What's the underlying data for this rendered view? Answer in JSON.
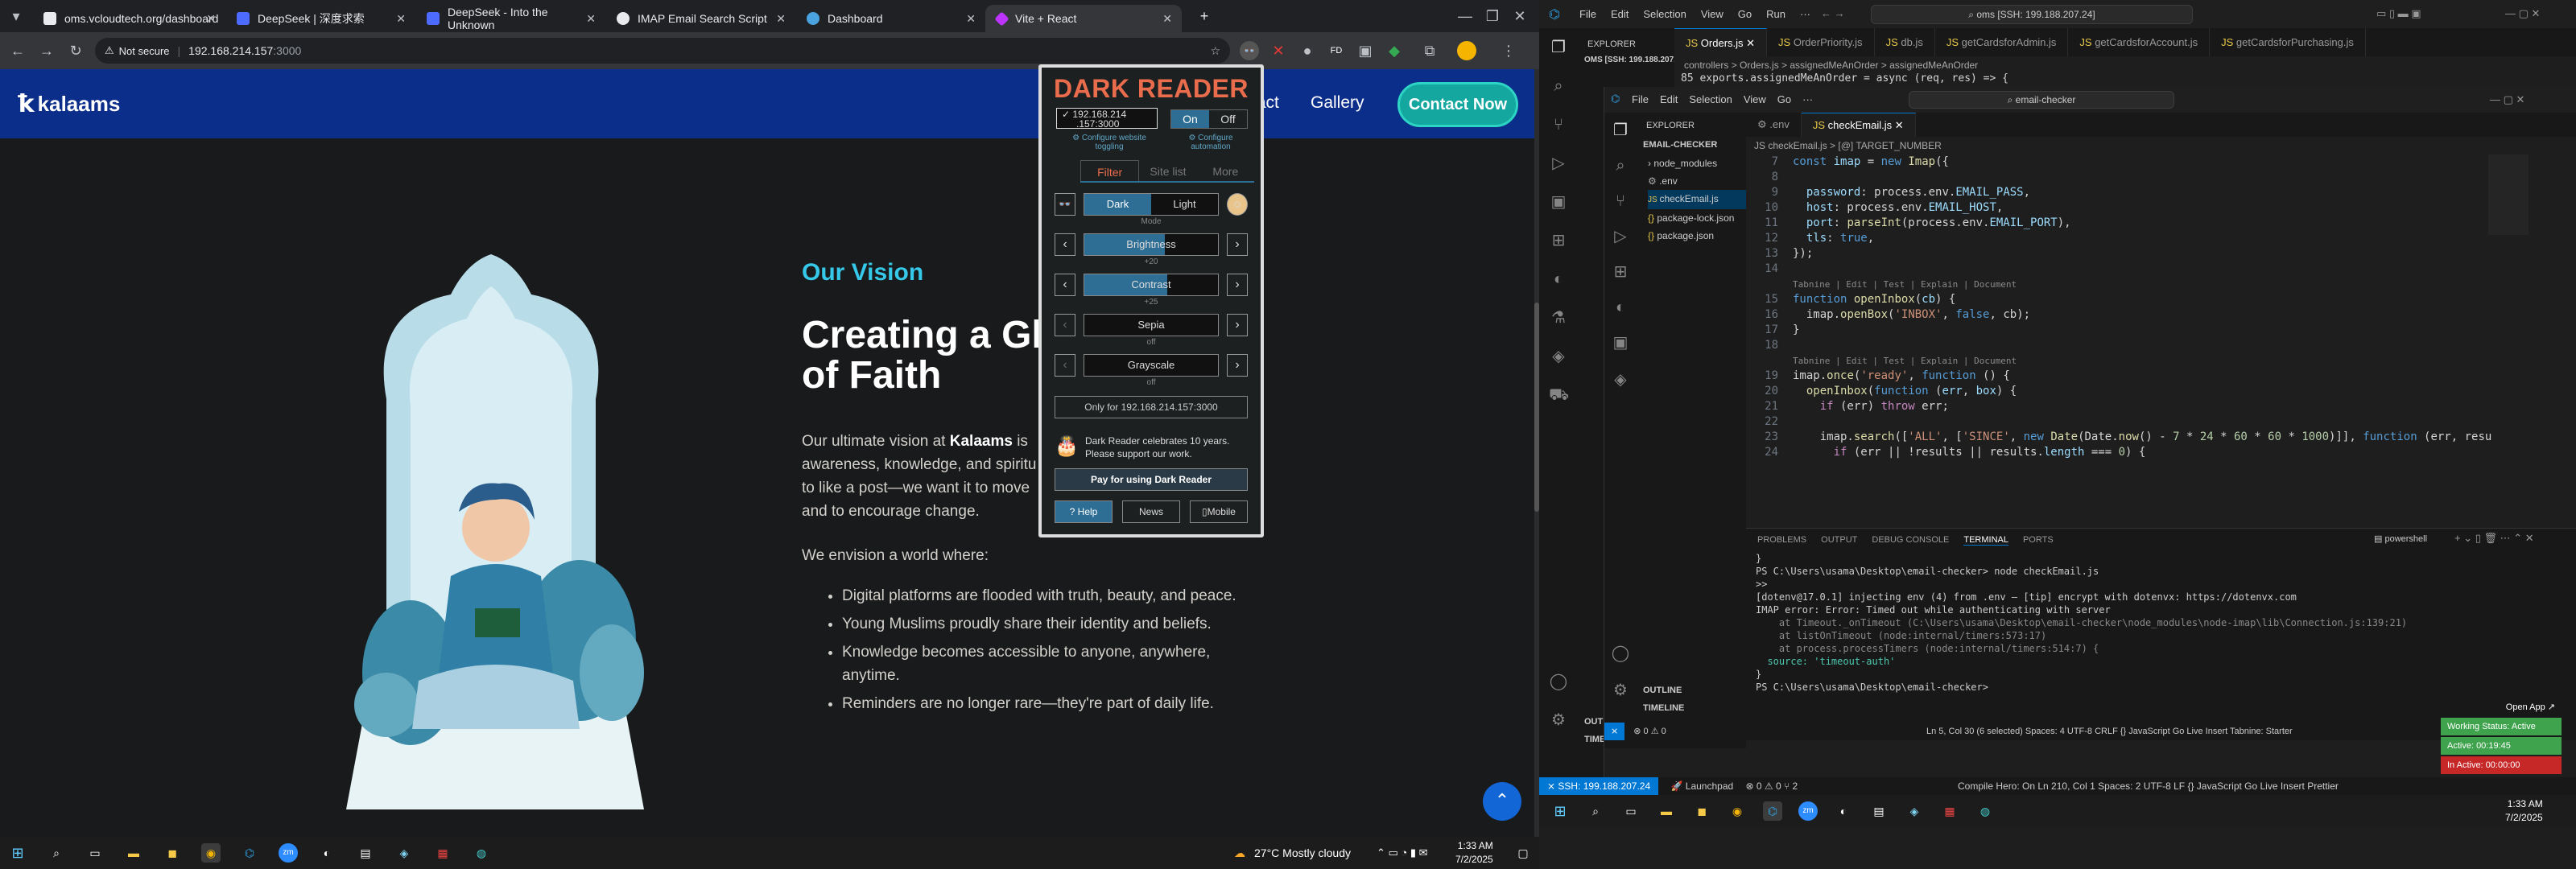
{
  "browser": {
    "tabs": [
      {
        "title": "oms.vcloudtech.org/dashboard",
        "color": "#e8eaed"
      },
      {
        "title": "DeepSeek | 深度求索",
        "color": "#4d6bfe"
      },
      {
        "title": "DeepSeek - Into the Unknown",
        "color": "#4d6bfe"
      },
      {
        "title": "IMAP Email Search Script",
        "color": "#e8eaed"
      },
      {
        "title": "Dashboard",
        "color": "#4aa3df"
      },
      {
        "title": "Vite + React",
        "color": "#bd34fe"
      }
    ],
    "security": "Not secure",
    "url": "192.168.214.157",
    "url_port": ":3000"
  },
  "site": {
    "logo": "kalaams",
    "nav": {
      "contact": "tact",
      "gallery": "Gallery",
      "contact_btn": "Contact Now"
    },
    "vision_heading": "Our Vision",
    "title_line1": "Creating a Gl",
    "title_line2": "of Faith",
    "para1_pre": "Our ultimate vision at ",
    "para1_bold": "Kalaams",
    "para1_post": " is",
    "para1_l2": "awareness, knowledge, and spiritu",
    "para1_l3": "to like a post—we want it to move",
    "para1_l4": "and to encourage change.",
    "envision": "We envision a world where:",
    "bullets": [
      "Digital platforms are flooded with truth, beauty, and peace.",
      "Young Muslims proudly share their identity and beliefs.",
      "Knowledge becomes accessible to anyone, anywhere, anytime.",
      "Reminders are no longer rare—they're part of daily life."
    ]
  },
  "dark_reader": {
    "title": "DARK READER",
    "site_l1": "✓ 192.168.214",
    "site_l2": ".157:3000",
    "on": "On",
    "off": "Off",
    "note1": "⚙ Configure website toggling",
    "note2": "⚙ Configure automation",
    "tabs": [
      "Filter",
      "Site list",
      "More"
    ],
    "mode": {
      "dark": "Dark",
      "light": "Light",
      "label": "Mode"
    },
    "sliders": [
      {
        "label": "Brightness",
        "value": "+20",
        "level": 0.6
      },
      {
        "label": "Contrast",
        "value": "+25",
        "level": 0.62
      },
      {
        "label": "Sepia",
        "value": "off",
        "level": 0
      },
      {
        "label": "Grayscale",
        "value": "off",
        "level": 0
      }
    ],
    "only_for": "Only for 192.168.214.157:3000",
    "celebrate_l1": "Dark Reader celebrates 10 years.",
    "celebrate_l2": "Please support our work.",
    "pay": "Pay for using Dark Reader",
    "help": "Help",
    "news": "News",
    "mobile": "Mobile"
  },
  "left_taskbar": {
    "weather": "27°C  Mostly cloudy",
    "time": "1:33 AM",
    "date": "7/2/2025"
  },
  "vscode": {
    "menu": [
      "File",
      "Edit",
      "Selection",
      "View",
      "Go",
      "Run",
      "···"
    ],
    "search": "oms [SSH: 199.188.207.24]",
    "tabs": [
      "Orders.js",
      "OrderPriority.js",
      "db.js",
      "getCardsforAdmin.js",
      "getCardsforAccount.js",
      "getCardsforPurchasing.js"
    ],
    "explorer": "EXPLORER",
    "oms_root": "OMS [SSH: 199.188.207.24]",
    "breadcrumb": "controllers > Orders.js > assignedMeAnOrder > assignedMeAnOrder",
    "outer_line": "85   exports.assignedMeAnOrder = async (req, res) => {",
    "inner": {
      "menu": [
        "File",
        "Edit",
        "Selection",
        "View",
        "Go",
        "···"
      ],
      "search": "email-checker",
      "explorer": "EXPLORER",
      "root": "EMAIL-CHECKER",
      "files": [
        "node_modules",
        ".env",
        "checkEmail.js",
        "package-lock.json",
        "package.json"
      ],
      "tabs": [
        ".env",
        "checkEmail.js"
      ],
      "breadcrumb": "JS checkEmail.js > [@] TARGET_NUMBER",
      "panel_tabs": [
        "PROBLEMS",
        "OUTPUT",
        "DEBUG CONSOLE",
        "TERMINAL",
        "PORTS"
      ],
      "shell": "powershell",
      "terminal": [
        "}",
        "PS C:\\Users\\usama\\Desktop\\email-checker> node checkEmail.js",
        ">>",
        "[dotenv@17.0.1] injecting env (4) from .env – [tip] encrypt with dotenvx: https://dotenvx.com",
        "IMAP error: Error: Timed out while authenticating with server",
        "    at Timeout._onTimeout (C:\\Users\\usama\\Desktop\\email-checker\\node_modules\\node-imap\\lib\\Connection.js:139:21)",
        "    at listOnTimeout (node:internal/timers:573:17)",
        "    at process.processTimers (node:internal/timers:514:7) {",
        "  source: 'timeout-auth'",
        "}",
        "PS C:\\Users\\usama\\Desktop\\email-checker> "
      ],
      "outline": "OUTLINE",
      "timeline": "TIMELINE",
      "status": "Ln 5, Col 30 (6 selected)   Spaces: 4   UTF-8   CRLF   {} JavaScript   Go Live   Insert   Tabnine: Starter"
    },
    "outline": "OUTLINE",
    "timeline": "TIMELINE",
    "ssh": "SSH: 199.188.207.24",
    "launchpad": "Launchpad",
    "status_right": "Compile Hero: On   Ln 210, Col 1   Spaces: 2   UTF-8   LF   {} JavaScript   Go Live   Insert   Prettier",
    "notif": {
      "open": "Open App ↗",
      "working": "Working Status: Active",
      "active": "Active: 00:19:45",
      "inactive": "In Active: 00:00:00"
    },
    "time": "1:33 AM",
    "date": "7/2/2025"
  }
}
